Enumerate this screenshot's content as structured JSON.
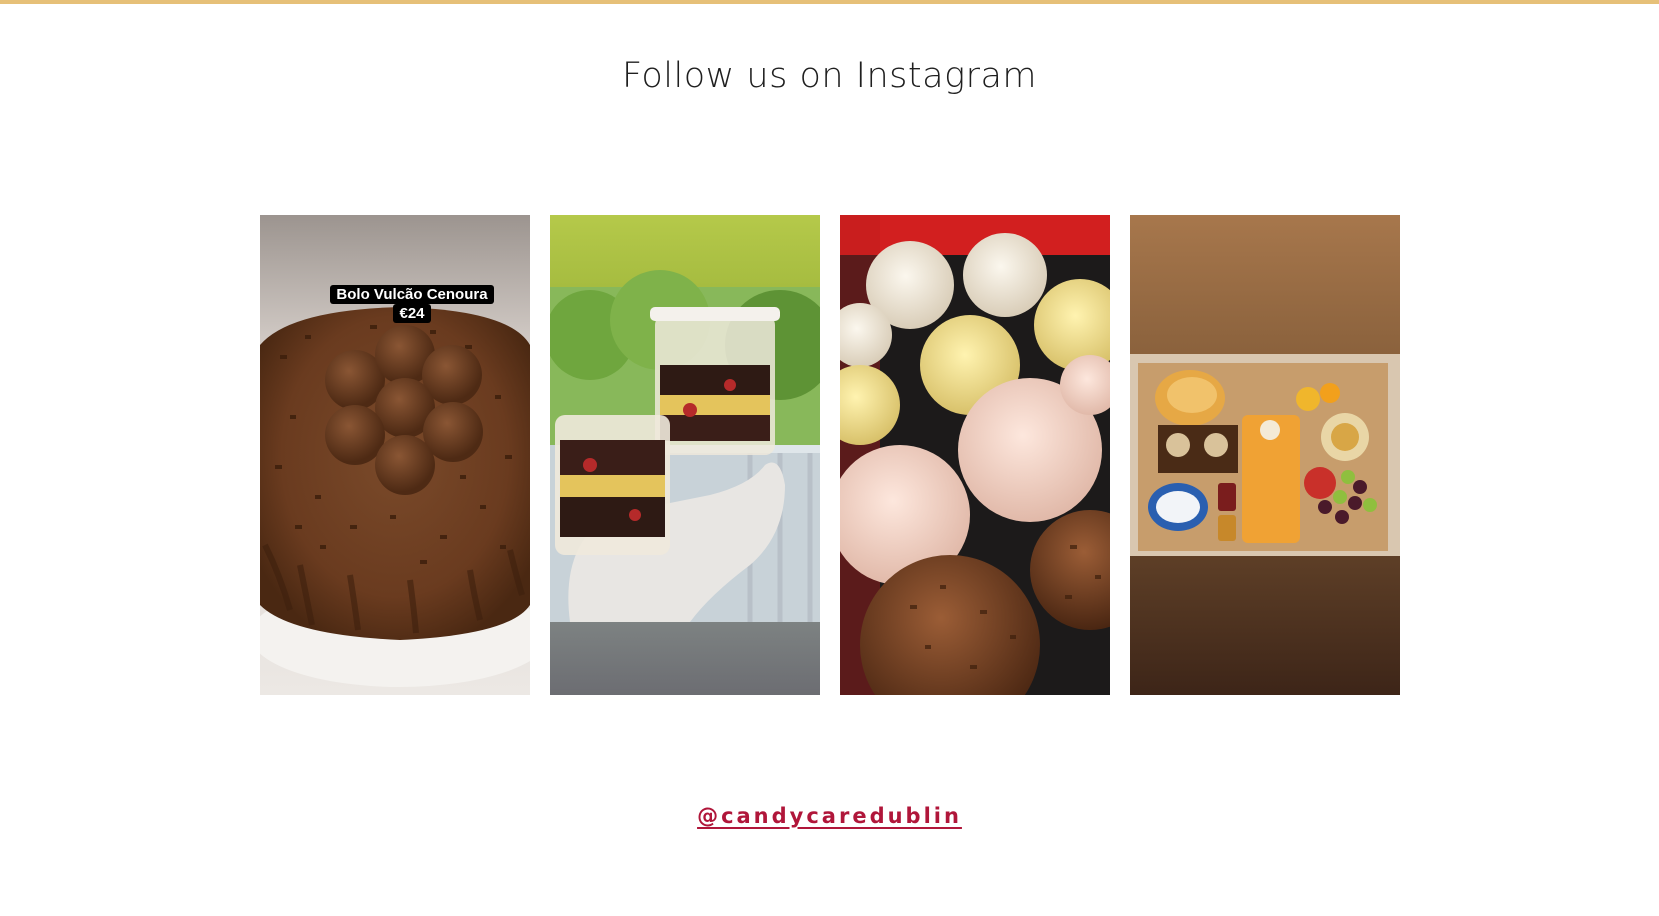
{
  "theme": {
    "accent_rule": "#e6c078",
    "link_color": "#b0163a"
  },
  "section": {
    "title": "Follow us on Instagram"
  },
  "posts": [
    {
      "id": "post-1",
      "sticker_line1": "Bolo Vulcão Cenoura",
      "sticker_line2": "€24"
    },
    {
      "id": "post-2"
    },
    {
      "id": "post-3"
    },
    {
      "id": "post-4"
    }
  ],
  "instagram": {
    "handle": "@candycaredublin"
  }
}
